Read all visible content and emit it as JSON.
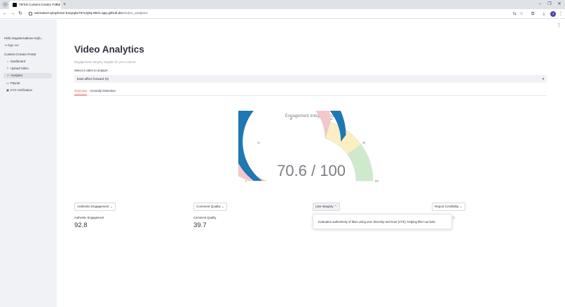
{
  "browser": {
    "tab_title": "TikTok Content Creator Portal",
    "tab_close": "×",
    "new_tab": "+",
    "url_host": "animated-xylophone-54xpq5x757v2j9q-8501.app.github.dev",
    "url_path": "/video_analytics",
    "avatar_initial": "J"
  },
  "sidebar": {
    "greeting": "Hello issgeda-babnee-Issjh...",
    "sign_out": "Sign out",
    "portal_title": "Content Creator Portal",
    "items": [
      {
        "label": "Dashboard",
        "icon": "home-icon",
        "active": false
      },
      {
        "label": "Upload Video",
        "icon": "upload-icon",
        "active": false
      },
      {
        "label": "Analytics",
        "icon": "chart-icon",
        "active": true
      },
      {
        "label": "Payout",
        "icon": "wallet-icon",
        "active": false
      },
      {
        "label": "KYC Verification",
        "icon": "id-card-icon",
        "active": false
      }
    ]
  },
  "main": {
    "title": "Video Analytics",
    "subtitle": "Engagement integrity insights for your content",
    "select_label": "Select a video to analyze",
    "select_value": "East affect forward (0)",
    "tabs": [
      {
        "label": "Overview",
        "active": true
      },
      {
        "label": "Anomaly Detection",
        "active": false
      }
    ]
  },
  "gauge": {
    "title": "Engagement Integrity Score",
    "value": 70.6,
    "max": 100,
    "display": "70.6 / 100",
    "ticks": [
      "0",
      "20",
      "40",
      "60",
      "80",
      "100"
    ],
    "colors": {
      "low": "#f4c7cc",
      "mid": "#fbeec2",
      "high": "#cfe9cd",
      "bar": "#1f77b4",
      "text": "#7b7f86"
    }
  },
  "metrics": [
    {
      "button": "Authentic Engagement",
      "label": "Authentic Engagement",
      "value": "92.8",
      "open": false
    },
    {
      "button": "Comment Quality",
      "label": "Comment Quality",
      "value": "39.7",
      "open": false
    },
    {
      "button": "Like Integrity",
      "label": "",
      "value": "",
      "open": true
    },
    {
      "button": "Report Credibility",
      "label": "",
      "value": "",
      "open": false
    }
  ],
  "tooltip": {
    "text": "Evaluates authenticity of likes using user diversity and trust (VTS), helping filter out bots."
  }
}
